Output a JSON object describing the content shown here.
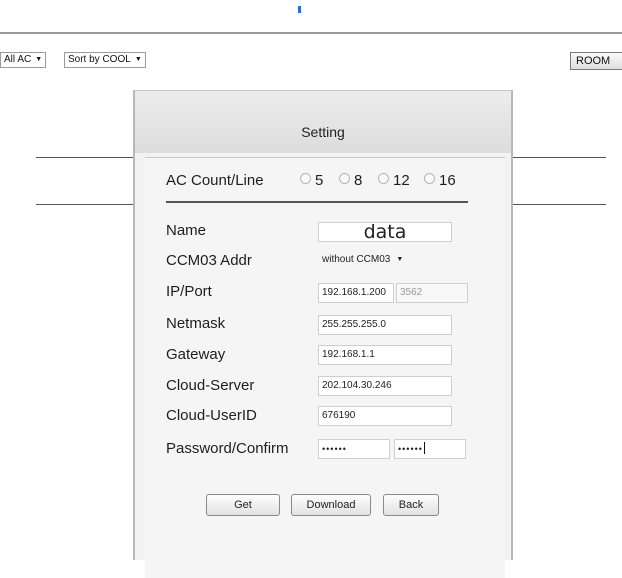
{
  "toolbar": {
    "filter_select": "All AC",
    "sort_select": "Sort by COOL",
    "room_button": "ROOM"
  },
  "dialog": {
    "title": "Setting",
    "ac_count": {
      "label": "AC Count/Line",
      "options": [
        "5",
        "8",
        "12",
        "16"
      ]
    },
    "fields": {
      "name": {
        "label": "Name",
        "value": "data"
      },
      "ccm03_addr": {
        "label": "CCM03 Addr",
        "value": "without CCM03"
      },
      "ip_port": {
        "label": "IP/Port",
        "ip": "192.168.1.200",
        "port": "3562"
      },
      "netmask": {
        "label": "Netmask",
        "value": "255.255.255.0"
      },
      "gateway": {
        "label": "Gateway",
        "value": "192.168.1.1"
      },
      "cloud_server": {
        "label": "Cloud-Server",
        "value": "202.104.30.246"
      },
      "cloud_userid": {
        "label": "Cloud-UserID",
        "value": "676190"
      },
      "password": {
        "label": "Password/Confirm",
        "password": "••••••",
        "confirm": "••••••"
      }
    },
    "buttons": {
      "get": "Get",
      "download": "Download",
      "back": "Back"
    }
  }
}
